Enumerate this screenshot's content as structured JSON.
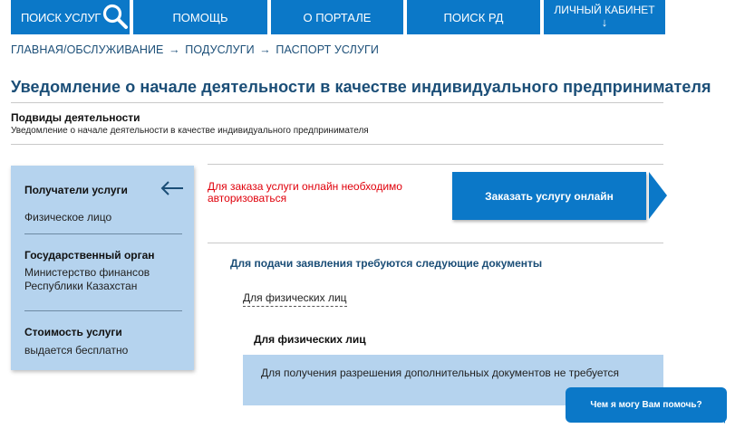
{
  "nav": {
    "search": "Поиск услуг",
    "help": "Помощь",
    "about": "О портале",
    "rd": "Поиск РД",
    "cabinet": "Личный кабинет",
    "cabinet_arrow": "↓"
  },
  "breadcrumb": {
    "item1": "Главная/Обслуживание",
    "item2": "Подуслуги",
    "item3": "Паспорт услуги",
    "sep": "→"
  },
  "page": {
    "title": "Уведомление о начале деятельности в качестве индивидуального предпринимателя",
    "subhead": "Подвиды деятельности",
    "subtext": "Уведомление о начале деятельности в качестве индивидуального предпринимателя"
  },
  "panel": {
    "recipients_title": "Получатели услуги",
    "recipients_value": "Физическое лицо",
    "agency_title": "Государственный орган",
    "agency_line1": "Министерство финансов",
    "agency_line2": "Республики Казахстан",
    "cost_title": "Стоимость услуги",
    "cost_value": "выдается бесплатно"
  },
  "order": {
    "warning": "Для заказа услуги онлайн необходимо авторизоваться",
    "button": "Заказать услугу онлайн"
  },
  "docs": {
    "heading": "Для подачи заявления требуются следующие документы",
    "tab_link": "Для физических лиц",
    "tab_heading": "Для физических лиц",
    "info": "Для получения разрешения дополнительных документов не требуется"
  },
  "chat": {
    "label": "Чем я могу Вам помочь?"
  },
  "colors": {
    "primary": "#0b78c8",
    "panel_bg": "#b5d3ee",
    "title": "#1b4e77",
    "warning": "#e0000b"
  }
}
